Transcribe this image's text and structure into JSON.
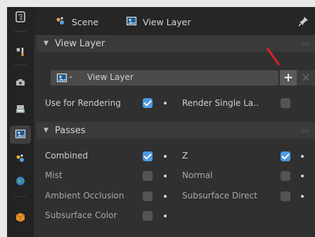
{
  "header": {
    "scene_label": "Scene",
    "view_layer_label": "View Layer"
  },
  "tabs": [
    {
      "icon": "tool-icon"
    },
    {
      "icon": "render-icon"
    },
    {
      "icon": "output-icon"
    },
    {
      "icon": "view-layer-icon",
      "active": true
    },
    {
      "icon": "scene-icon"
    },
    {
      "icon": "world-icon"
    },
    {
      "icon": "object-icon"
    }
  ],
  "view_layer_panel": {
    "title": "View Layer",
    "field_value": "View Layer",
    "add_label": "+",
    "remove_label": "✕",
    "use_for_rendering": {
      "label": "Use for Rendering",
      "checked": true
    },
    "render_single_layer": {
      "label": "Render Single La..",
      "checked": false
    }
  },
  "passes_panel": {
    "title": "Passes",
    "items": [
      {
        "label": "Combined",
        "checked": true
      },
      {
        "label": "Z",
        "checked": true
      },
      {
        "label": "Mist",
        "checked": false
      },
      {
        "label": "Normal",
        "checked": false
      },
      {
        "label": "Ambient Occlusion",
        "checked": false
      },
      {
        "label": "Subsurface Direct",
        "checked": false
      },
      {
        "label": "Subsurface Color",
        "checked": false
      }
    ]
  },
  "colors": {
    "accent": "#4a9ae0",
    "annotation_arrow": "#e02020"
  }
}
